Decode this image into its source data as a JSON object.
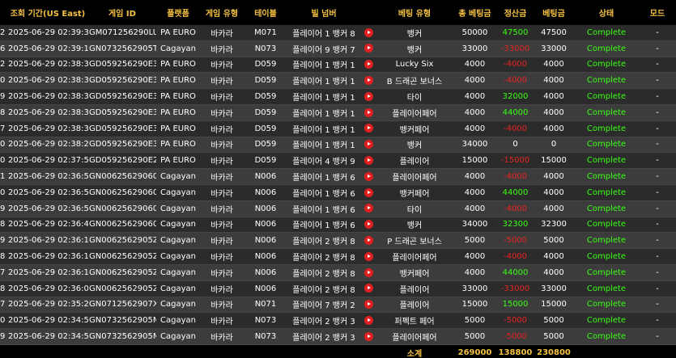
{
  "headers": {
    "idx": "",
    "period": "조회 기간(US East)",
    "game_id": "게임 ID",
    "platform": "플랫폼",
    "game_type": "게임 유형",
    "table": "테이블",
    "bill_number": "빌 넘버",
    "play": "",
    "bet_type": "베팅 유형",
    "total_bet": "총 베팅금",
    "settlement": "정산금",
    "bet_amount": "베팅금",
    "status": "상태",
    "mode": "모드"
  },
  "rows": [
    {
      "idx": "2",
      "datetime": "2025-06-29 02:39:39",
      "game_id": "GM071256290LU",
      "platform": "PA EURO",
      "game_type": "바카라",
      "table": "M071",
      "bill": "플레이어 1 뱅커 8",
      "bet_type": "뱅커",
      "total_bet": "50000",
      "settlement": "47500",
      "settle_color": "green",
      "bet": "47500",
      "status": "Complete",
      "mode": "-"
    },
    {
      "idx": "6",
      "datetime": "2025-06-29 02:39:10",
      "game_id": "GN0732562905T",
      "platform": "Cagayan",
      "game_type": "바카라",
      "table": "N073",
      "bill": "플레이어 9 뱅커 7",
      "bet_type": "뱅커",
      "total_bet": "33000",
      "settlement": "-33000",
      "settle_color": "red",
      "bet": "33000",
      "status": "Complete",
      "mode": "-"
    },
    {
      "idx": "2",
      "datetime": "2025-06-29 02:38:36",
      "game_id": "GD059256290E3",
      "platform": "PA EURO",
      "game_type": "바카라",
      "table": "D059",
      "bill": "플레이어 1 뱅커 1",
      "bet_type": "Lucky Six",
      "total_bet": "4000",
      "settlement": "-4000",
      "settle_color": "red",
      "bet": "4000",
      "status": "Complete",
      "mode": "-"
    },
    {
      "idx": "0",
      "datetime": "2025-06-29 02:38:36",
      "game_id": "GD059256290E3",
      "platform": "PA EURO",
      "game_type": "바카라",
      "table": "D059",
      "bill": "플레이어 1 뱅커 1",
      "bet_type": "B 드래곤 보너스",
      "total_bet": "4000",
      "settlement": "-4000",
      "settle_color": "red",
      "bet": "4000",
      "status": "Complete",
      "mode": "-"
    },
    {
      "idx": "9",
      "datetime": "2025-06-29 02:38:36",
      "game_id": "GD059256290E3",
      "platform": "PA EURO",
      "game_type": "바카라",
      "table": "D059",
      "bill": "플레이어 1 뱅커 1",
      "bet_type": "타이",
      "total_bet": "4000",
      "settlement": "32000",
      "settle_color": "green",
      "bet": "4000",
      "status": "Complete",
      "mode": "-"
    },
    {
      "idx": "8",
      "datetime": "2025-06-29 02:38:31",
      "game_id": "GD059256290E3",
      "platform": "PA EURO",
      "game_type": "바카라",
      "table": "D059",
      "bill": "플레이어 1 뱅커 1",
      "bet_type": "플레이어페어",
      "total_bet": "4000",
      "settlement": "44000",
      "settle_color": "green",
      "bet": "4000",
      "status": "Complete",
      "mode": "-"
    },
    {
      "idx": "7",
      "datetime": "2025-06-29 02:38:31",
      "game_id": "GD059256290E3",
      "platform": "PA EURO",
      "game_type": "바카라",
      "table": "D059",
      "bill": "플레이어 1 뱅커 1",
      "bet_type": "뱅커페어",
      "total_bet": "4000",
      "settlement": "-4000",
      "settle_color": "red",
      "bet": "4000",
      "status": "Complete",
      "mode": "-"
    },
    {
      "idx": "0",
      "datetime": "2025-06-29 02:38:22",
      "game_id": "GD059256290E3",
      "platform": "PA EURO",
      "game_type": "바카라",
      "table": "D059",
      "bill": "플레이어 1 뱅커 1",
      "bet_type": "뱅커",
      "total_bet": "34000",
      "settlement": "0",
      "settle_color": "white",
      "bet": "0",
      "status": "Complete",
      "mode": "-"
    },
    {
      "idx": "0",
      "datetime": "2025-06-29 02:37:51",
      "game_id": "GD059256290E2",
      "platform": "PA EURO",
      "game_type": "바카라",
      "table": "D059",
      "bill": "플레이어 4 뱅커 9",
      "bet_type": "플레이어",
      "total_bet": "15000",
      "settlement": "-15000",
      "settle_color": "red",
      "bet": "15000",
      "status": "Complete",
      "mode": "-"
    },
    {
      "idx": "1",
      "datetime": "2025-06-29 02:36:55",
      "game_id": "GN00625629060",
      "platform": "Cagayan",
      "game_type": "바카라",
      "table": "N006",
      "bill": "플레이어 1 뱅커 6",
      "bet_type": "플레이어페어",
      "total_bet": "4000",
      "settlement": "-4000",
      "settle_color": "red",
      "bet": "4000",
      "status": "Complete",
      "mode": "-"
    },
    {
      "idx": "0",
      "datetime": "2025-06-29 02:36:55",
      "game_id": "GN00625629060",
      "platform": "Cagayan",
      "game_type": "바카라",
      "table": "N006",
      "bill": "플레이어 1 뱅커 6",
      "bet_type": "뱅커페어",
      "total_bet": "4000",
      "settlement": "44000",
      "settle_color": "green",
      "bet": "4000",
      "status": "Complete",
      "mode": "-"
    },
    {
      "idx": "9",
      "datetime": "2025-06-29 02:36:55",
      "game_id": "GN00625629060",
      "platform": "Cagayan",
      "game_type": "바카라",
      "table": "N006",
      "bill": "플레이어 1 뱅커 6",
      "bet_type": "타이",
      "total_bet": "4000",
      "settlement": "-4000",
      "settle_color": "red",
      "bet": "4000",
      "status": "Complete",
      "mode": "-"
    },
    {
      "idx": "8",
      "datetime": "2025-06-29 02:36:43",
      "game_id": "GN00625629060",
      "platform": "Cagayan",
      "game_type": "바카라",
      "table": "N006",
      "bill": "플레이어 1 뱅커 6",
      "bet_type": "뱅커",
      "total_bet": "34000",
      "settlement": "32300",
      "settle_color": "green",
      "bet": "32300",
      "status": "Complete",
      "mode": "-"
    },
    {
      "idx": "9",
      "datetime": "2025-06-29 02:36:16",
      "game_id": "GN0062562905Z",
      "platform": "Cagayan",
      "game_type": "바카라",
      "table": "N006",
      "bill": "플레이어 2 뱅커 8",
      "bet_type": "P 드래곤 보너스",
      "total_bet": "5000",
      "settlement": "-5000",
      "settle_color": "red",
      "bet": "5000",
      "status": "Complete",
      "mode": "-"
    },
    {
      "idx": "8",
      "datetime": "2025-06-29 02:36:16",
      "game_id": "GN0062562905Z",
      "platform": "Cagayan",
      "game_type": "바카라",
      "table": "N006",
      "bill": "플레이어 2 뱅커 8",
      "bet_type": "플레이어페어",
      "total_bet": "4000",
      "settlement": "-4000",
      "settle_color": "red",
      "bet": "4000",
      "status": "Complete",
      "mode": "-"
    },
    {
      "idx": "7",
      "datetime": "2025-06-29 02:36:16",
      "game_id": "GN0062562905Z",
      "platform": "Cagayan",
      "game_type": "바카라",
      "table": "N006",
      "bill": "플레이어 2 뱅커 8",
      "bet_type": "뱅커페어",
      "total_bet": "4000",
      "settlement": "44000",
      "settle_color": "green",
      "bet": "4000",
      "status": "Complete",
      "mode": "-"
    },
    {
      "idx": "8",
      "datetime": "2025-06-29 02:36:03",
      "game_id": "GN0062562905Z",
      "platform": "Cagayan",
      "game_type": "바카라",
      "table": "N006",
      "bill": "플레이어 2 뱅커 8",
      "bet_type": "플레이어",
      "total_bet": "33000",
      "settlement": "-33000",
      "settle_color": "red",
      "bet": "33000",
      "status": "Complete",
      "mode": "-"
    },
    {
      "idx": "7",
      "datetime": "2025-06-29 02:35:29",
      "game_id": "GN0712562907X",
      "platform": "Cagayan",
      "game_type": "바카라",
      "table": "N071",
      "bill": "플레이어 7 뱅커 2",
      "bet_type": "플레이어",
      "total_bet": "15000",
      "settlement": "15000",
      "settle_color": "green",
      "bet": "15000",
      "status": "Complete",
      "mode": "-"
    },
    {
      "idx": "0",
      "datetime": "2025-06-29 02:34:56",
      "game_id": "GN0732562905M",
      "platform": "Cagayan",
      "game_type": "바카라",
      "table": "N073",
      "bill": "플레이어 2 뱅커 3",
      "bet_type": "퍼펙트 페어",
      "total_bet": "5000",
      "settlement": "-5000",
      "settle_color": "red",
      "bet": "5000",
      "status": "Complete",
      "mode": "-"
    },
    {
      "idx": "9",
      "datetime": "2025-06-29 02:34:56",
      "game_id": "GN0732562905M",
      "platform": "Cagayan",
      "game_type": "바카라",
      "table": "N073",
      "bill": "플레이어 2 뱅커 3",
      "bet_type": "플레이어페어",
      "total_bet": "5000",
      "settlement": "-5000",
      "settle_color": "red",
      "bet": "5000",
      "status": "Complete",
      "mode": "-"
    }
  ],
  "totals": {
    "label": "소계",
    "total_bet": "269000",
    "settlement": "138800",
    "bet": "230800"
  },
  "colors": {
    "header_text": "#f5c242",
    "complete": "#39ff14",
    "win": "#39ff14",
    "loss": "#e82323",
    "play_icon": "#e02020"
  }
}
